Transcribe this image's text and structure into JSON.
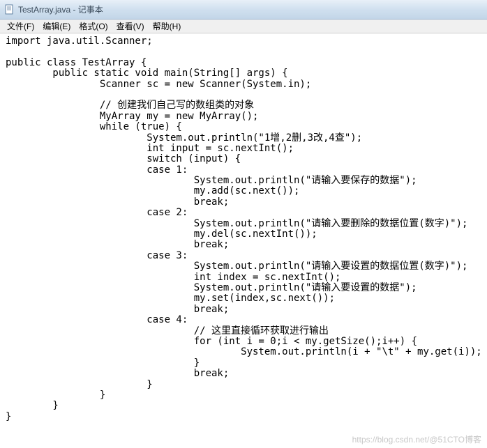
{
  "window": {
    "title": "TestArray.java - 记事本"
  },
  "menu": {
    "file": "文件(F)",
    "edit": "编辑(E)",
    "format": "格式(O)",
    "view": "查看(V)",
    "help": "帮助(H)"
  },
  "code": "import java.util.Scanner;\n\npublic class TestArray {\n        public static void main(String[] args) {\n                Scanner sc = new Scanner(System.in);\n\n                // 创建我们自己写的数组类的对象\n                MyArray my = new MyArray();\n                while (true) {\n                        System.out.println(\"1增,2删,3改,4查\");\n                        int input = sc.nextInt();\n                        switch (input) {\n                        case 1:\n                                System.out.println(\"请输入要保存的数据\");\n                                my.add(sc.next());\n                                break;\n                        case 2:\n                                System.out.println(\"请输入要删除的数据位置(数字)\");\n                                my.del(sc.nextInt());\n                                break;\n                        case 3:\n                                System.out.println(\"请输入要设置的数据位置(数字)\");\n                                int index = sc.nextInt();\n                                System.out.println(\"请输入要设置的数据\");\n                                my.set(index,sc.next());\n                                break;\n                        case 4:\n                                // 这里直接循环获取进行输出\n                                for (int i = 0;i < my.getSize();i++) {\n                                        System.out.println(i + \"\\t\" + my.get(i));\n                                }\n                                break;\n                        }\n                }\n        }\n}",
  "watermark": "https://blog.csdn.net/@51CTO博客"
}
